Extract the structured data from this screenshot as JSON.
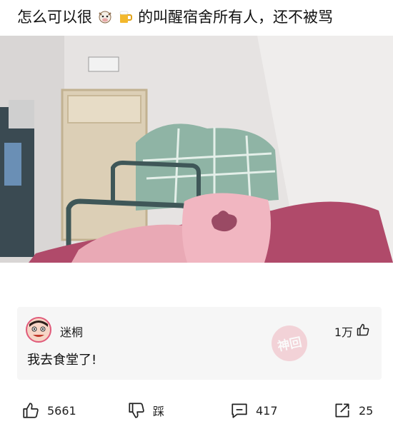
{
  "post": {
    "title_part1": "怎么可以很",
    "title_part2": "的叫醒宿舍所有人，还不被骂",
    "emojis": [
      "cow-icon",
      "beer-icon"
    ]
  },
  "comment": {
    "username": "迷桐",
    "like_count": "1万",
    "text": "我去食堂了!",
    "watermark_text": "神回"
  },
  "actions": {
    "like_count": "5661",
    "dislike_label": "踩",
    "comment_count": "417",
    "share_count": "25"
  }
}
